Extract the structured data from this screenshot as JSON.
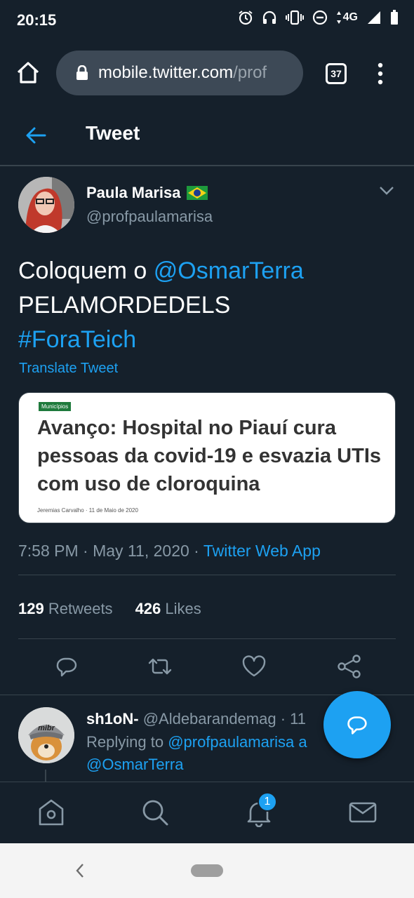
{
  "status_bar": {
    "time": "20:15",
    "network": "4G",
    "icons": [
      "alarm-icon",
      "headphones-icon",
      "vibrate-icon",
      "dnd-icon",
      "data-arrows-icon",
      "signal-icon",
      "battery-icon"
    ]
  },
  "browser": {
    "url_host": "mobile.twitter.com",
    "url_rest": "/prof",
    "tab_count": "37"
  },
  "header": {
    "title": "Tweet"
  },
  "tweet": {
    "author_name": "Paula Marisa",
    "author_handle": "@profpaulamarisa",
    "text_prefix": "Coloquem o ",
    "mention": "@OsmarTerra",
    "text_line2": "PELAMORDEDELS",
    "hashtag": "#ForaTeich",
    "translate": "Translate Tweet",
    "card": {
      "badge": "Municípios",
      "headline": "Avanço: Hospital no Piauí cura pessoas da covid-19 e esvazia UTIs com uso de cloroquina",
      "byline": "Jeremias Carvalho  ·  11 de Maio de 2020"
    },
    "time": "7:58 PM",
    "date": "May 11, 2020",
    "source": "Twitter Web App",
    "retweets_count": "129",
    "retweets_label": "Retweets",
    "likes_count": "426",
    "likes_label": "Likes"
  },
  "reply": {
    "name": "sh1oN-",
    "handle": "@Aldebarandemag · 11",
    "replying_prefix": "Replying to ",
    "replying_to": "@profpaulamarisa a",
    "replying_line2": "@OsmarTerra",
    "avatar_text": "mibr"
  },
  "bottom_nav": {
    "notifications_badge": "1"
  },
  "colors": {
    "background": "#15202b",
    "accent": "#1da1f2",
    "muted": "#8899a6",
    "divider": "#38444d"
  }
}
